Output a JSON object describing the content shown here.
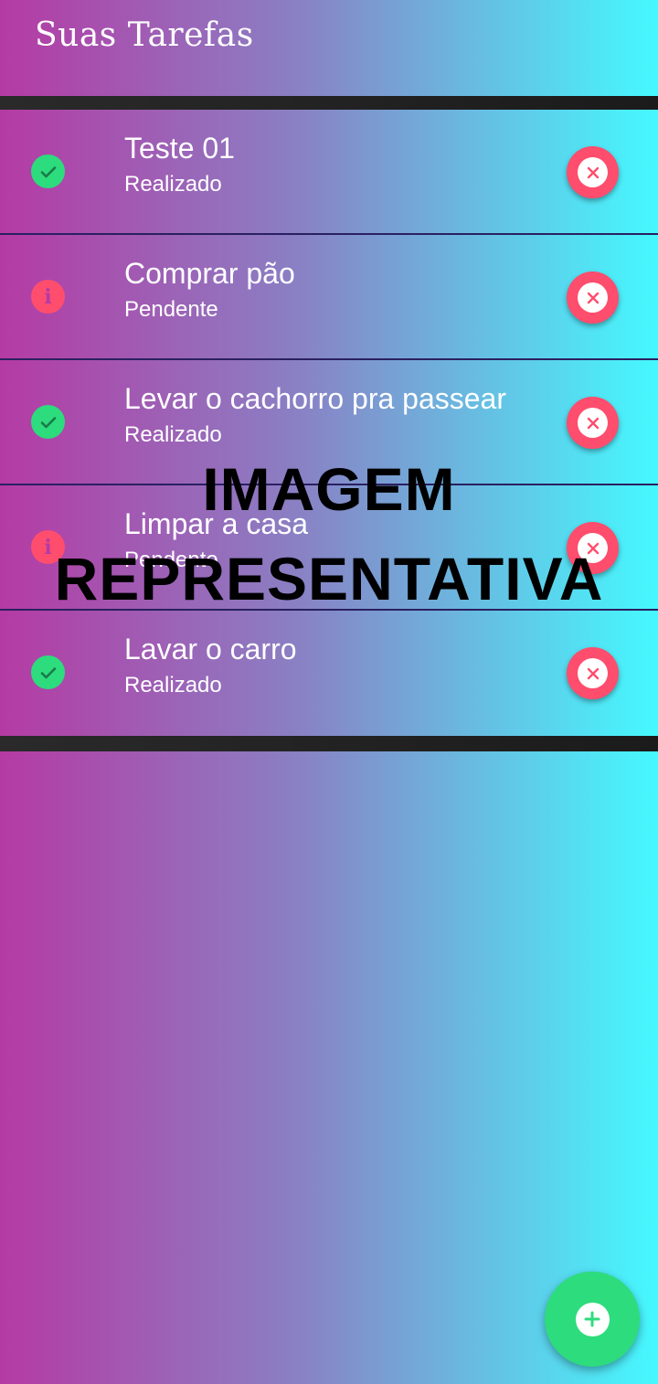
{
  "app_bar": {
    "title": "Suas Tarefas"
  },
  "tasks": [
    {
      "title": "Teste 01",
      "status": "Realizado",
      "done": true
    },
    {
      "title": "Comprar pão",
      "status": "Pendente",
      "done": false
    },
    {
      "title": "Levar o cachorro pra passear",
      "status": "Realizado",
      "done": true
    },
    {
      "title": "Limpar a casa",
      "status": "Pendente",
      "done": false
    },
    {
      "title": "Lavar o carro",
      "status": "Realizado",
      "done": true
    }
  ],
  "watermark": {
    "line1": "IMAGEM",
    "line2": "REPRESENTATIVA"
  },
  "icons": {
    "done": "check-circle-icon",
    "pending": "info-circle-icon",
    "delete": "close-circle-icon",
    "add": "add-circle-icon"
  },
  "colors": {
    "gradient_start": "#b53aa4",
    "gradient_end": "#45f9ff",
    "done": "#2ddc7c",
    "pending": "#ff4d6d",
    "delete": "#ff4d6d",
    "fab": "#2ddc7c"
  }
}
